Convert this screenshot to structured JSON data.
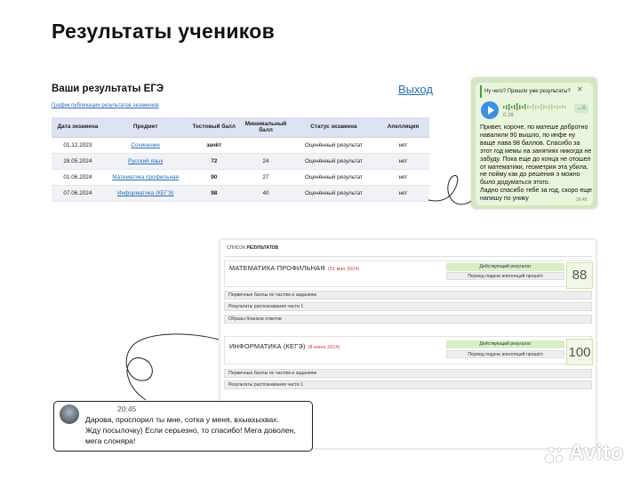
{
  "page_title": "Результаты учеников",
  "ege": {
    "heading": "Ваши результаты ЕГЭ",
    "logout": "Выход",
    "schedule_link": "График публикации результатов экзаменов",
    "columns": [
      "Дата экзамена",
      "Предмет",
      "Тестовый балл",
      "Минимальный балл",
      "Статус экзамена",
      "Апелляция"
    ],
    "rows": [
      {
        "date": "01.12.2023",
        "subject": "Сочинение",
        "score": "зачёт",
        "min": "",
        "status": "Оценённый результат",
        "appeal": "нет"
      },
      {
        "date": "28.05.2024",
        "subject": "Русский язык",
        "score": "72",
        "min": "24",
        "status": "Оценённый результат",
        "appeal": "нет"
      },
      {
        "date": "01.06.2024",
        "subject": "Математика профильная",
        "score": "90",
        "min": "27",
        "status": "Оценённый результат",
        "appeal": "нет"
      },
      {
        "date": "07.06.2024",
        "subject": "Информатика (КЕГЭ)",
        "score": "98",
        "min": "40",
        "status": "Оценённый результат",
        "appeal": "нет"
      }
    ]
  },
  "telegram": {
    "reply_text": "Ну чего? Пришли уже результаты?",
    "voice_duration": "0:26",
    "transcribe": "→A",
    "message": "Привет, короче, по матеше добротно навалили 90 вышло, по инфе ну ваще лава 98 баллов. Спасибо за этот год мемы на занятиях никогда не забуду. Пока еще до конца не отошел от математики, геометрия эта убила, не пойму как до решения э можно было додуматься этого.\nЛадно спасибо тебе за год, скоро еще напишу по унику",
    "time": "16:45"
  },
  "results_list": {
    "header_prefix": "список",
    "header_bold": "результатов",
    "subjects": [
      {
        "title": "Математика профильная",
        "date": "(31 мая 2024)",
        "status": "Действующий результат",
        "appeal": "Период подачи апелляций прошёл",
        "score": "88",
        "sections": [
          "Первичные баллы по частям и заданиям",
          "Результаты распознавания части 1",
          "Образы бланков ответов"
        ]
      },
      {
        "title": "Информатика (КЕГЭ)",
        "date": "(8 июня 2024)",
        "status": "Действующий результат",
        "appeal": "Период подачи апелляций прошёл",
        "score": "100",
        "sections": [
          "Первичные баллы по частям и заданиям",
          "Результаты распознавания части 1"
        ]
      }
    ]
  },
  "chat_message": {
    "time": "20:45",
    "text": "Дарова, проспорил ты мне, сотка у меня, вхыахыхвах.\nЖду посылочку) Если серьезно, то спасибо! Мега доволен, мега слоняра!"
  },
  "watermark": "Avito",
  "colors": {
    "link": "#2a6ebb",
    "score_green": "#18a318",
    "tg_bubble": "#e9f5dc",
    "date_red": "#c33"
  }
}
